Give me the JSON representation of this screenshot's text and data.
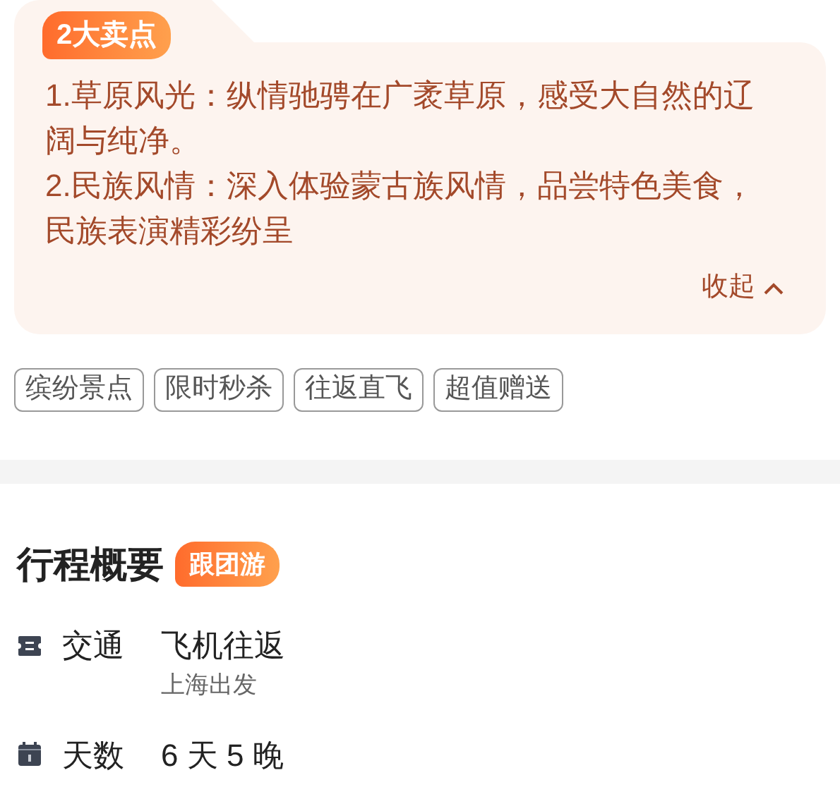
{
  "highlights": {
    "badge": "2大卖点",
    "points": [
      "1.草原风光：纵情驰骋在广袤草原，感受大自然的辽阔与纯净。",
      "2.民族风情：深入体验蒙古族风情，品尝特色美食，民族表演精彩纷呈"
    ],
    "collapse": "收起",
    "expanded": true
  },
  "tags": [
    "缤纷景点",
    "限时秒杀",
    "往返直飞",
    "超值赠送"
  ],
  "overview": {
    "title": "行程概要",
    "badge": "跟团游",
    "rows": [
      {
        "kind": "transport",
        "label": "交通",
        "value": "飞机往返",
        "sub": "上海出发"
      },
      {
        "kind": "days",
        "label": "天数",
        "value": "6 天 5 晚"
      }
    ]
  }
}
